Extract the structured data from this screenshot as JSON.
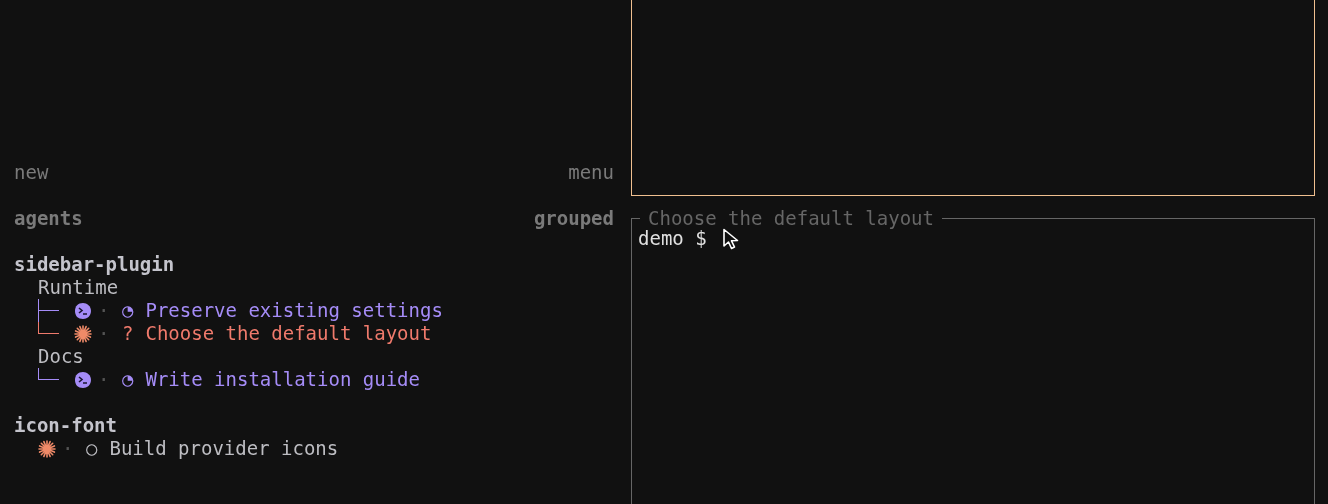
{
  "sidebar": {
    "header": {
      "left": "new",
      "right": "menu"
    },
    "view": {
      "left": "agents",
      "right": "grouped"
    },
    "projects": [
      {
        "name": "sidebar-plugin",
        "children": [
          {
            "kind": "group",
            "name": "Runtime",
            "children": [
              {
                "kind": "task",
                "agent": {
                  "kind": "terminal"
                },
                "separator": "·",
                "status": "◔",
                "title": "Preserve existing settings",
                "color": "#a58cf7"
              },
              {
                "kind": "task",
                "agent": {
                  "kind": "spark"
                },
                "separator": "·",
                "status": "?",
                "title": "Choose the default layout",
                "color": "#ef7a6c"
              }
            ]
          },
          {
            "kind": "group",
            "name": "Docs",
            "children": [
              {
                "kind": "task",
                "agent": {
                  "kind": "terminal"
                },
                "separator": "·",
                "status": "◔",
                "title": "Write installation guide",
                "color": "#a58cf7"
              }
            ]
          }
        ]
      },
      {
        "name": "icon-font",
        "children": [
          {
            "kind": "task",
            "agent": {
              "kind": "spark"
            },
            "separator": "·",
            "status": "○",
            "title": "Build provider icons",
            "color": "#bdbdc2"
          }
        ]
      }
    ]
  },
  "panes": [
    {
      "focused": true
    },
    {
      "focused": false,
      "title": "Choose the default layout",
      "lines": [
        "demo $"
      ]
    }
  ]
}
